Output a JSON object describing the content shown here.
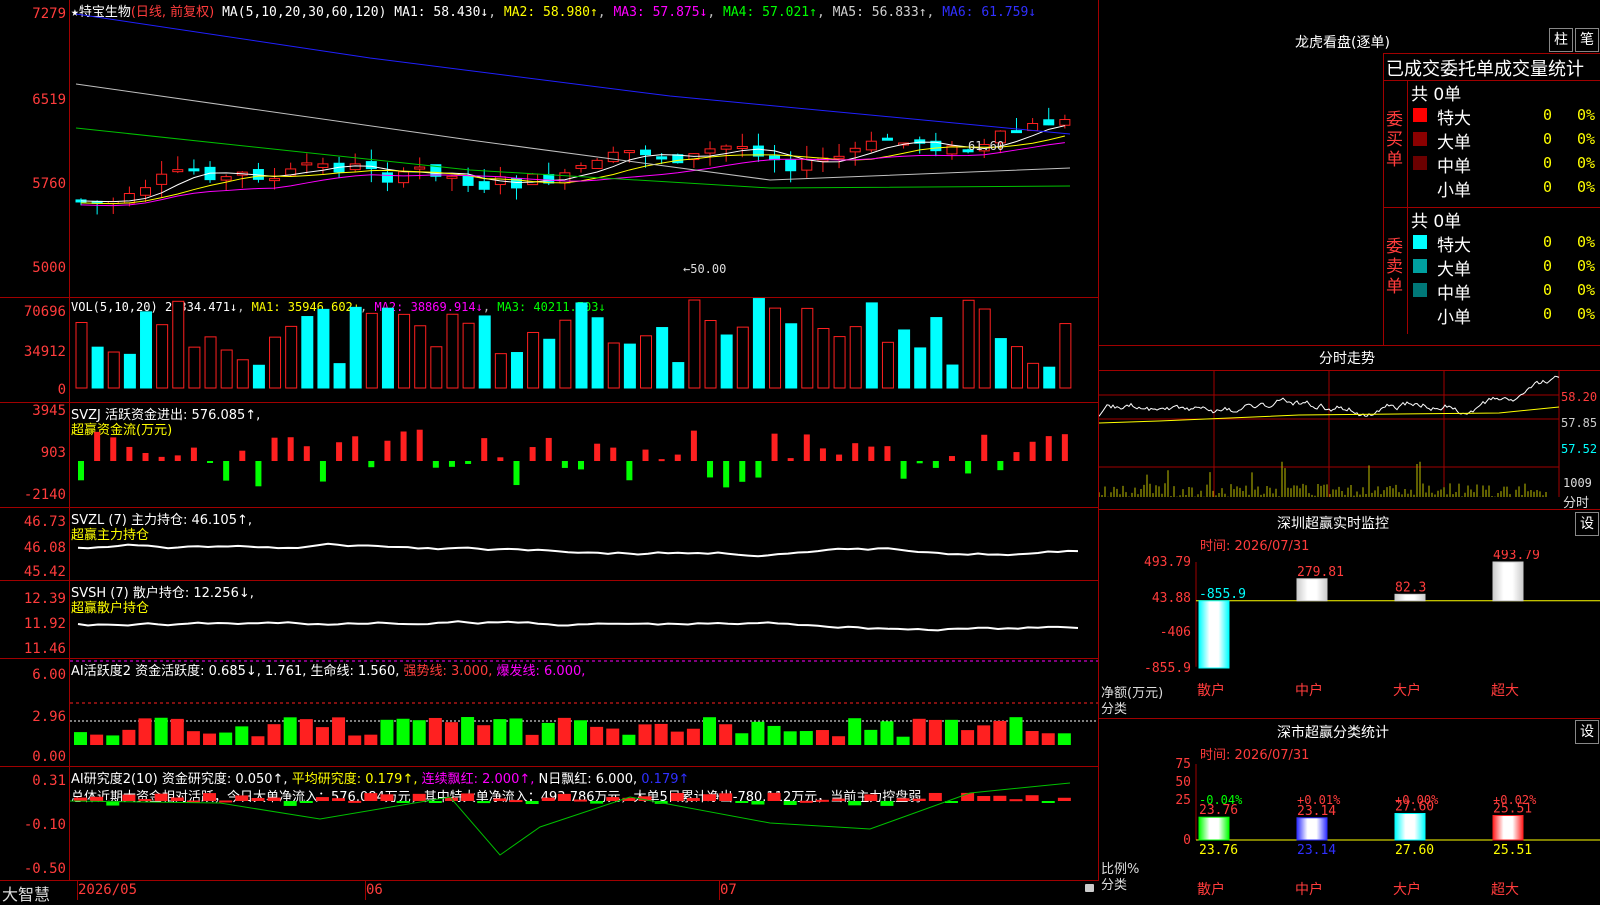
{
  "stock_header": {
    "star": "★",
    "name": "特宝生物",
    "period": "(日线, 前复权)",
    "ma_params": "MA(5,10,20,30,60,120)",
    "ma1": "MA1: 58.430↓",
    "ma2": "MA2: 58.980↑",
    "ma3": "MA3: 57.875↓",
    "ma4": "MA4: 57.021↑",
    "ma5": "MA5: 56.833↑",
    "ma6": "MA6: 61.759↓"
  },
  "price_axis": [
    "7279",
    "6519",
    "5760",
    "5000"
  ],
  "price_annotations": {
    "high": "61.60",
    "low": "←50.00"
  },
  "vol": {
    "title": "VOL(5,10,20)",
    "value": "28334.471↓",
    "ma1": "MA1: 35946.602↓",
    "ma2": "MA2: 38869.914↓",
    "ma3": "MA3: 40211.703↓",
    "axis": [
      "70696",
      "34912",
      "0"
    ]
  },
  "svzj": {
    "title": "SVZJ  活跃资金进出: 576.085↑,",
    "subtitle": "超赢资金流(万元)",
    "axis": [
      "3945",
      "903",
      "-2140"
    ]
  },
  "svzl": {
    "title": "SVZL (7) 主力持仓: 46.105↑,",
    "subtitle": "超赢主力持仓",
    "axis": [
      "46.73",
      "46.08",
      "45.42"
    ]
  },
  "svsh": {
    "title": "SVSH (7) 散户持仓: 12.256↓,",
    "subtitle": "超赢散户持仓",
    "axis": [
      "12.39",
      "11.92",
      "11.46"
    ]
  },
  "ai1": {
    "title": "AI活跃度2 资金活跃度: 0.685↓, 1.761, 生命线: 1.560,",
    "strong": "强势线: 3.000,",
    "burst": "爆发线: 6.000,",
    "axis": [
      "6.00",
      "2.96",
      "0.00"
    ]
  },
  "ai2": {
    "title": "AI研究度2(10) 资金研究度: 0.050↑,",
    "avg": "平均研究度: 0.179↑,",
    "cont": "连续飘红: 2.000↑,",
    "nday": "N日飘红: 6.000,",
    "last": "0.179↑",
    "summary": "总体近期大资金相对活跃，今日大单净流入：576.084万元，其中特大单净流入：493.786万元，大单5日累计净出-780.112万元，当前主力控盘弱",
    "axis": [
      "0.31",
      "-0.10",
      "-0.50"
    ]
  },
  "bottom_bar": {
    "brand": "大智慧",
    "dates": [
      "2026/05",
      "06",
      "07"
    ]
  },
  "dragon_tiger": {
    "title": "龙虎看盘(逐单)",
    "btn_col": "柱",
    "btn_bi": "笔",
    "tabs_label": "已成交委托单成交量统计",
    "buy_label": "委买单",
    "sell_label": "委卖单",
    "buy_total": "共 0单",
    "sell_total": "共 0单",
    "buy_rows": [
      {
        "name": "特大",
        "count": "0",
        "pct": "0%",
        "color": "#ff0000"
      },
      {
        "name": "大单",
        "count": "0",
        "pct": "0%",
        "color": "#8b0000"
      },
      {
        "name": "中单",
        "count": "0",
        "pct": "0%",
        "color": "#6b0000"
      },
      {
        "name": "小单",
        "count": "0",
        "pct": "0%",
        "color": "#000000"
      }
    ],
    "sell_rows": [
      {
        "name": "特大",
        "count": "0",
        "pct": "0%",
        "color": "#00ffff"
      },
      {
        "name": "大单",
        "count": "0",
        "pct": "0%",
        "color": "#00a0a0"
      },
      {
        "name": "中单",
        "count": "0",
        "pct": "0%",
        "color": "#007878"
      },
      {
        "name": "小单",
        "count": "0",
        "pct": "0%",
        "color": "#000000"
      }
    ]
  },
  "intraday": {
    "title": "分时走势",
    "price_axis": [
      "58.20",
      "57.85",
      "57.52"
    ],
    "vol_axis": [
      "1009",
      "分时"
    ]
  },
  "sz_monitor": {
    "title": "深圳超赢实时监控",
    "settings": "设",
    "time": "时间: 2026/07/31",
    "axis": [
      "493.79",
      "43.88",
      "-406",
      "-855.9"
    ],
    "axis_label": "净额(万元)",
    "axis_label2": "分类",
    "categories": [
      "散户",
      "中户",
      "大户",
      "超大"
    ],
    "values": [
      -855.9,
      279.81,
      82.3,
      493.79
    ],
    "value_labels": [
      "-855.9",
      "279.81",
      "82.3",
      "493.79"
    ]
  },
  "sz_stats": {
    "title": "深市超赢分类统计",
    "settings": "设",
    "time": "时间: 2026/07/31",
    "axis": [
      "75",
      "50",
      "25",
      "0"
    ],
    "axis_label": "比例%",
    "axis_label2": "分类",
    "categories": [
      "散户",
      "中户",
      "大户",
      "超大"
    ],
    "values": [
      23.76,
      23.14,
      27.6,
      25.51
    ],
    "value_labels": [
      "23.76",
      "23.14",
      "27.60",
      "25.51"
    ],
    "changes": [
      "-0.04%",
      "+0.01%",
      "+0.00%",
      "+0.02%"
    ]
  },
  "colors": {
    "up": "#ff2020",
    "down": "#00ffff",
    "grid": "#a00000",
    "yellow": "#ffff00"
  }
}
